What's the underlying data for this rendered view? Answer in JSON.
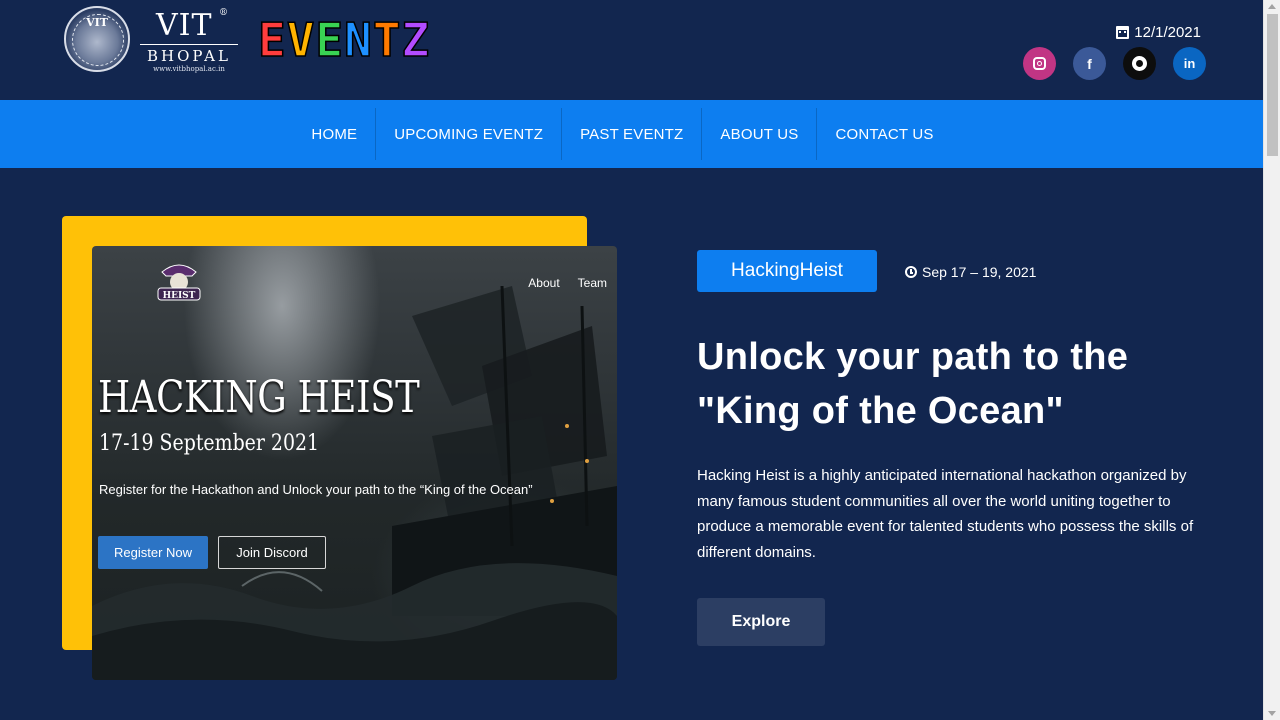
{
  "header": {
    "vit_logo": {
      "seal_text": "VIT",
      "name": "VIT",
      "registered": "®",
      "subtitle": "BHOPAL",
      "url": "www.vitbhopal.ac.in"
    },
    "eventz_logo": {
      "letters": [
        "E",
        "V",
        "E",
        "N",
        "T",
        "Z"
      ],
      "colors": [
        "#ff3d3d",
        "#ffb300",
        "#39d353",
        "#1e90ff",
        "#ff7a00",
        "#b24cff"
      ]
    },
    "date": "12/1/2021",
    "date_icon": "calendar-icon",
    "socials": [
      {
        "name": "instagram",
        "icon": "instagram-icon",
        "color": "#c13584"
      },
      {
        "name": "facebook",
        "icon": "facebook-icon",
        "glyph": "f",
        "color": "#3b5998"
      },
      {
        "name": "github",
        "icon": "github-icon",
        "color": "#0d0d0d"
      },
      {
        "name": "linkedin",
        "icon": "linkedin-icon",
        "glyph": "in",
        "color": "#0a66c2"
      }
    ]
  },
  "nav": {
    "items": [
      "HOME",
      "UPCOMING EVENTZ",
      "PAST EVENTZ",
      "ABOUT US",
      "CONTACT US"
    ],
    "background": "#0d7ef0"
  },
  "hero": {
    "poster": {
      "nav": [
        "About",
        "Team"
      ],
      "title": "HACKING HEIST",
      "date": "17-19 September 2021",
      "tagline": "Register for the Hackathon and Unlock your path to the “King of the Ocean”",
      "register_label": "Register Now",
      "discord_label": "Join Discord",
      "logo_text": "HEIST"
    },
    "tag": "HackingHeist",
    "event_date": "Sep 17 – 19, 2021",
    "headline": "Unlock your path to the \"King of the Ocean\"",
    "description": "Hacking Heist is a highly anticipated international hackathon organized by many famous student communities all over the world uniting together to produce a memorable event for talented students who possess the skills of different domains.",
    "explore_label": "Explore"
  },
  "colors": {
    "page_background": "#12264f",
    "accent_blue": "#0d7ef0",
    "accent_yellow": "#ffc107",
    "explore_button": "#2c3e63"
  }
}
